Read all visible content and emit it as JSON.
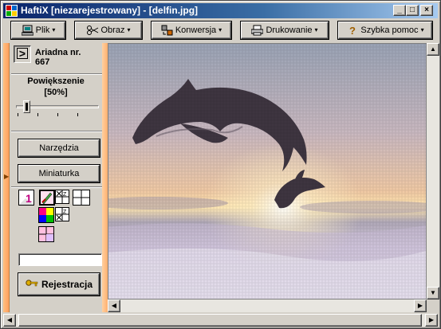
{
  "window": {
    "title": "HaftiX [niezarejestrowany] - [delfin.jpg]",
    "min_glyph": "_",
    "max_glyph": "□",
    "close_glyph": "×"
  },
  "toolbar": {
    "items": [
      {
        "label": "Plik",
        "icon": "computer-icon"
      },
      {
        "label": "Obraz",
        "icon": "scissors-icon"
      },
      {
        "label": "Konwersja",
        "icon": "convert-icon"
      },
      {
        "label": "Drukowanie",
        "icon": "printer-icon"
      },
      {
        "label": "Szybka pomoc",
        "icon": "help-icon"
      }
    ],
    "caret": "▾"
  },
  "panel": {
    "next_glyph": ">",
    "ariadna_label": "Ariadna nr.",
    "ariadna_number": "667",
    "zoom_title": "Powiększenie",
    "zoom_value": "[50%]",
    "tools_button": "Narzędzia",
    "thumbnail_button": "Miniaturka",
    "register_button": "Rejestracja",
    "register_input": ""
  },
  "colors": {
    "title_start": "#0a246a",
    "title_end": "#a6caf0",
    "accent_orange": "#ffa060"
  }
}
